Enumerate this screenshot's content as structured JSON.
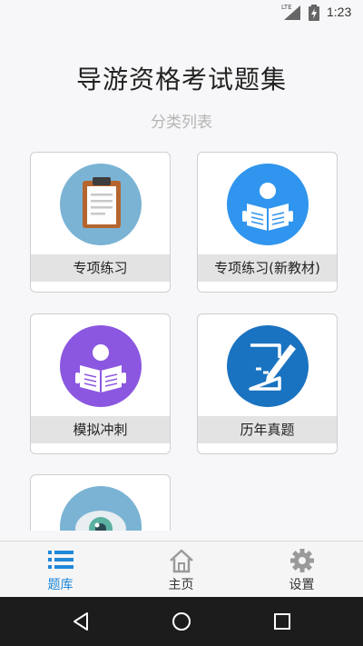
{
  "status_bar": {
    "network": "LTE",
    "time": "1:23"
  },
  "header": {
    "title": "导游资格考试题集",
    "subtitle": "分类列表"
  },
  "categories": [
    {
      "label": "专项练习",
      "icon": "clipboard-icon",
      "color": "#7ab3d4"
    },
    {
      "label": "专项练习(新教材)",
      "icon": "reader-icon",
      "color": "#2f95ee"
    },
    {
      "label": "模拟冲刺",
      "icon": "reader-icon",
      "color": "#8b57e0"
    },
    {
      "label": "历年真题",
      "icon": "pen-paper-icon",
      "color": "#1a73c0"
    },
    {
      "label": "",
      "icon": "eye-icon",
      "color": "#7ab3d4"
    }
  ],
  "bottom_nav": [
    {
      "label": "题库",
      "icon": "list-icon",
      "active": true
    },
    {
      "label": "主页",
      "icon": "home-icon",
      "active": false
    },
    {
      "label": "设置",
      "icon": "gear-icon",
      "active": false
    }
  ],
  "colors": {
    "accent": "#1e88d9",
    "inactive": "#9a9a9a"
  }
}
